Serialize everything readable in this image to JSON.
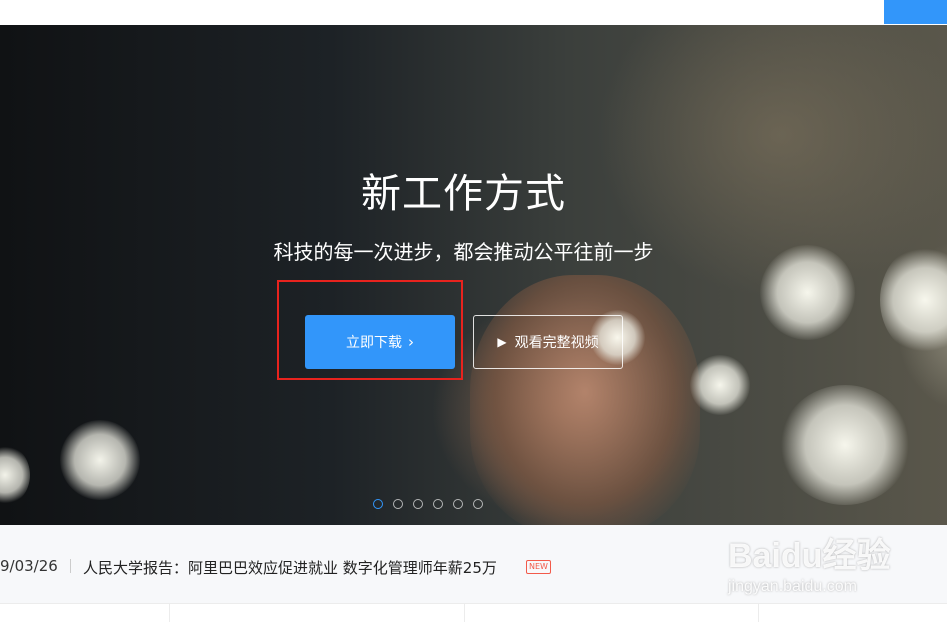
{
  "hero": {
    "title": "新工作方式",
    "subtitle": "科技的每一次进步，都会推动公平往前一步",
    "download_button": "立即下载",
    "download_chevron": "›",
    "video_button": "观看完整视频",
    "play_symbol": "▶",
    "carousel_dots": 6,
    "active_dot": 1
  },
  "news": {
    "date": "9/03/26",
    "headline": "人民大学报告：阿里巴巴效应促进就业 数字化管理师年薪25万",
    "badge": "NEW"
  },
  "watermark": {
    "logo": "Baidu经验",
    "url": "jingyan.baidu.com"
  },
  "colors": {
    "accent": "#3296fa",
    "highlight": "#e8231e",
    "new_badge": "#f25a4a"
  }
}
